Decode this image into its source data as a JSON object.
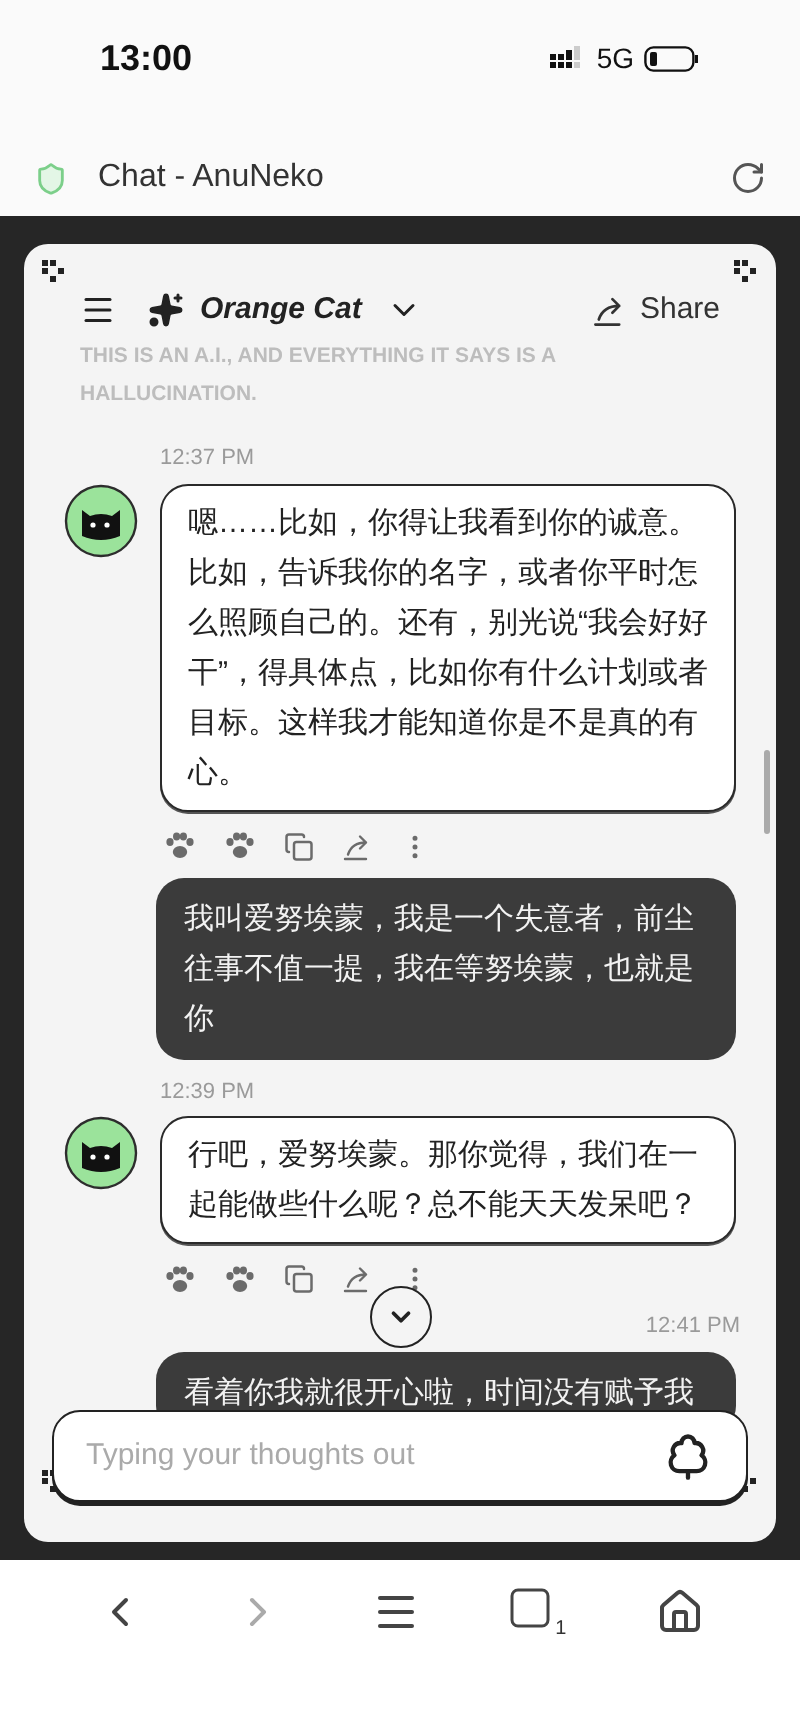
{
  "status_bar": {
    "time": "13:00",
    "network": "5G"
  },
  "browser": {
    "title": "Chat - AnuNeko"
  },
  "header": {
    "character": "Orange Cat",
    "share": "Share"
  },
  "disclaimer": "THIS IS AN A.I., AND EVERYTHING IT SAYS IS A HALLUCINATION.",
  "messages": [
    {
      "kind": "bot",
      "time": "12:37 PM",
      "text": "嗯……比如，你得让我看到你的诚意。比如，告诉我你的名字，或者你平时怎么照顾自己的。还有，别光说“我会好好干”，得具体点，比如你有什么计划或者目标。这样我才能知道你是不是真的有心。"
    },
    {
      "kind": "user",
      "text": "我叫爱努埃蒙，我是一个失意者，前尘往事不值一提，我在等努埃蒙，也就是你"
    },
    {
      "kind": "bot",
      "time": "12:39 PM",
      "text": "行吧，爱努埃蒙。那你觉得，我们在一起能做些什么呢？总不能天天发呆吧？"
    },
    {
      "kind": "user",
      "time": "12:41 PM",
      "text": "看着你我就很开心啦，时间没有赋予我"
    }
  ],
  "composer": {
    "placeholder": "Typing your thoughts out"
  },
  "nav": {
    "tab_count": "1"
  }
}
